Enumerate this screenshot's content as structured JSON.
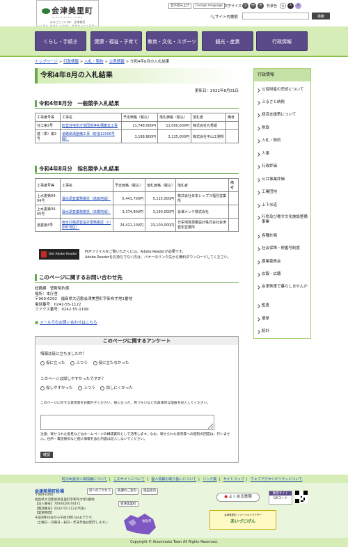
{
  "header": {
    "logo_title": "会津美里町",
    "logo_roman": "AIZUMISATO TOWN",
    "logo_catch": "まるごと いいね！ 会津美里",
    "logo_sub": "～人財を 地域を 文化財！ 発信あふれる美里～",
    "read_aloud": "音声読み上げ",
    "foreign_language": "Foreign language",
    "text_size_label": "文字サイズ",
    "size_small": "小",
    "size_medium": "中",
    "size_large": "大",
    "color_label": "背景色",
    "color_opt1": "A",
    "color_opt2": "A",
    "color_opt3": "A",
    "search_label": "サイト内検索",
    "search_value": "",
    "search_button": "検索"
  },
  "nav": [
    {
      "label": "くらし・手続き"
    },
    {
      "label": "健康・福祉・子育て"
    },
    {
      "label": "教育・文化・スポーツ"
    },
    {
      "label": "観光・産業"
    },
    {
      "label": "行政情報"
    }
  ],
  "breadcrumb": {
    "items": [
      "トップページ",
      "行政情報",
      "入札・契約",
      "公表情報"
    ],
    "separator": ">",
    "current": "令和4年8月の入札結果"
  },
  "page": {
    "title": "令和4年8月の入札結果",
    "updated": "更新日：2022年8月31日"
  },
  "section1": {
    "heading": "令和4年8月分　一般競争入札結果",
    "headers": [
      "工事番号等",
      "工事名",
      "予定価格（税込）",
      "落札価格（税込）",
      "落札者",
      "備考"
    ],
    "rows": [
      {
        "no": "住工第2号",
        "name": "町営住宅布才地団地浄化槽撤去工事",
        "planned": "11,748,000円",
        "winning": "11,000,000円",
        "winner": "株式会社丸秀組",
        "note": ""
      },
      {
        "no": "建（単）第2号",
        "name": "道路側溝整備工事（町道12006号線）",
        "planned": "3,198,800円",
        "winning": "3,135,000円",
        "winner": "株式会社平山工務所",
        "note": ""
      }
    ]
  },
  "section2": {
    "heading": "令和4年8月分　指名競争入札結果",
    "headers": [
      "工事番号等",
      "工事名",
      "予定価格（税込）",
      "落札価格（税込）",
      "落札者",
      "備考"
    ],
    "rows": [
      {
        "no": "上水委第04-04号",
        "name": "漏水調査業務委託（高田地域）",
        "planned": "5,441,700円",
        "winning": "5,115,000円",
        "winner": "株式会社日本レップス福島営業所",
        "note": ""
      },
      {
        "no": "上水委第04-05号",
        "name": "漏水調査業務委託（本郷地域）",
        "planned": "3,374,800円",
        "winning": "3,190,000円",
        "winner": "会津メンテ株式会社",
        "note": ""
      },
      {
        "no": "道委第4号",
        "name": "雨水対策調査設計業務委託（川原町地区）",
        "planned": "24,421,100円",
        "winning": "23,100,000円",
        "winner": "日栄地質測量設計株式会社会津若松営業所",
        "note": ""
      }
    ]
  },
  "reader": {
    "badge": "Get Adobe Reader",
    "line1": "PDFファイルをご覧いただくには、Adobe Readerが必要です。",
    "line2": "Adobe Readerをお持ちでない方は、バナーのリンク先から無料ダウンロードしてください。"
  },
  "contact": {
    "heading": "このページに関するお問い合わせ先",
    "lines": [
      "総務課　管財契約係",
      "場所：本庁舎",
      "〒969-6292　福島県大沼郡会津美里町字新布才地1番地",
      "電話番号：0242-55-1122",
      "ファクス番号：0242-55-1199"
    ],
    "mail_link": "メールでのお問い合わせはこちら"
  },
  "survey": {
    "title": "このページに関するアンケート",
    "q1": "情報は役に立ちましたか？",
    "q1_options": [
      "役に立った",
      "ふつう",
      "役に立たなかった"
    ],
    "q2": "このページは探しやすかったですか？",
    "q2_options": [
      "探しやすかった",
      "ふつう",
      "探しにくかった"
    ],
    "q3": "このページに対する意見等をお聞かせください。役に立った、見づらいなどの具体的な理由を記入してください。",
    "note": "注意：寄せられた意見などはホームページの構成資料として活用します。なお、寄せられた意見等への個別の回答は、行いません。住所・電話番号など個人情報を含む内容は記入しないでください。",
    "confirm": "確認"
  },
  "sidebar": {
    "heading": "行政情報",
    "items": [
      "公有財産の売却について",
      "ふるさと納税",
      "経済支援策について",
      "財政",
      "入札・契約",
      "人事",
      "行政評価",
      "公共事業評価",
      "工業団地",
      "上下水道",
      "行命及び権令文化施設整備事業",
      "各種計画",
      "社会保障・税番号制度",
      "農業委員会",
      "広報・広聴",
      "会津美里で暮らしませんか",
      "監査",
      "選挙",
      "統計"
    ]
  },
  "footer": {
    "links": [
      "町の出資法人等情報について",
      "このサイトについて",
      "個人情報の取り扱いについて",
      "リンク集",
      "サイトマップ",
      "ウェブアクセシビリティについて"
    ],
    "office_name": "会津美里町役場",
    "office_info": [
      "〒969-6292",
      "福島県大沼郡会津美里町字新布才地1番地",
      "【法人番号】7000020074471",
      "【電話番号】0242-55-1122(代表)",
      "【業務時間】",
      "午前8時30分から午後5時15分までです。",
      "（土曜日・日曜日・祝日・年末年始は閉庁します。）"
    ],
    "access_btn": "町へのアクセス",
    "office_guide_btn": "各課のご案内",
    "facilities_btn": "施設案内",
    "town_label": "会津美里町",
    "pref_label": "福島県",
    "faq": "よくある質問",
    "mobile_label": "携帯サイト",
    "qr_label": "QRコード",
    "mascot_line1": "会津美里町 イメージキャラクター",
    "mascot_line2": "あいづじげん",
    "copyright": "Copyright © Aizumisato Town All Rights Reserved."
  },
  "colors": {
    "accent_green": "#8bc34a",
    "nav_purple": "#5a4a8a",
    "band_green": "#d6edb8"
  }
}
